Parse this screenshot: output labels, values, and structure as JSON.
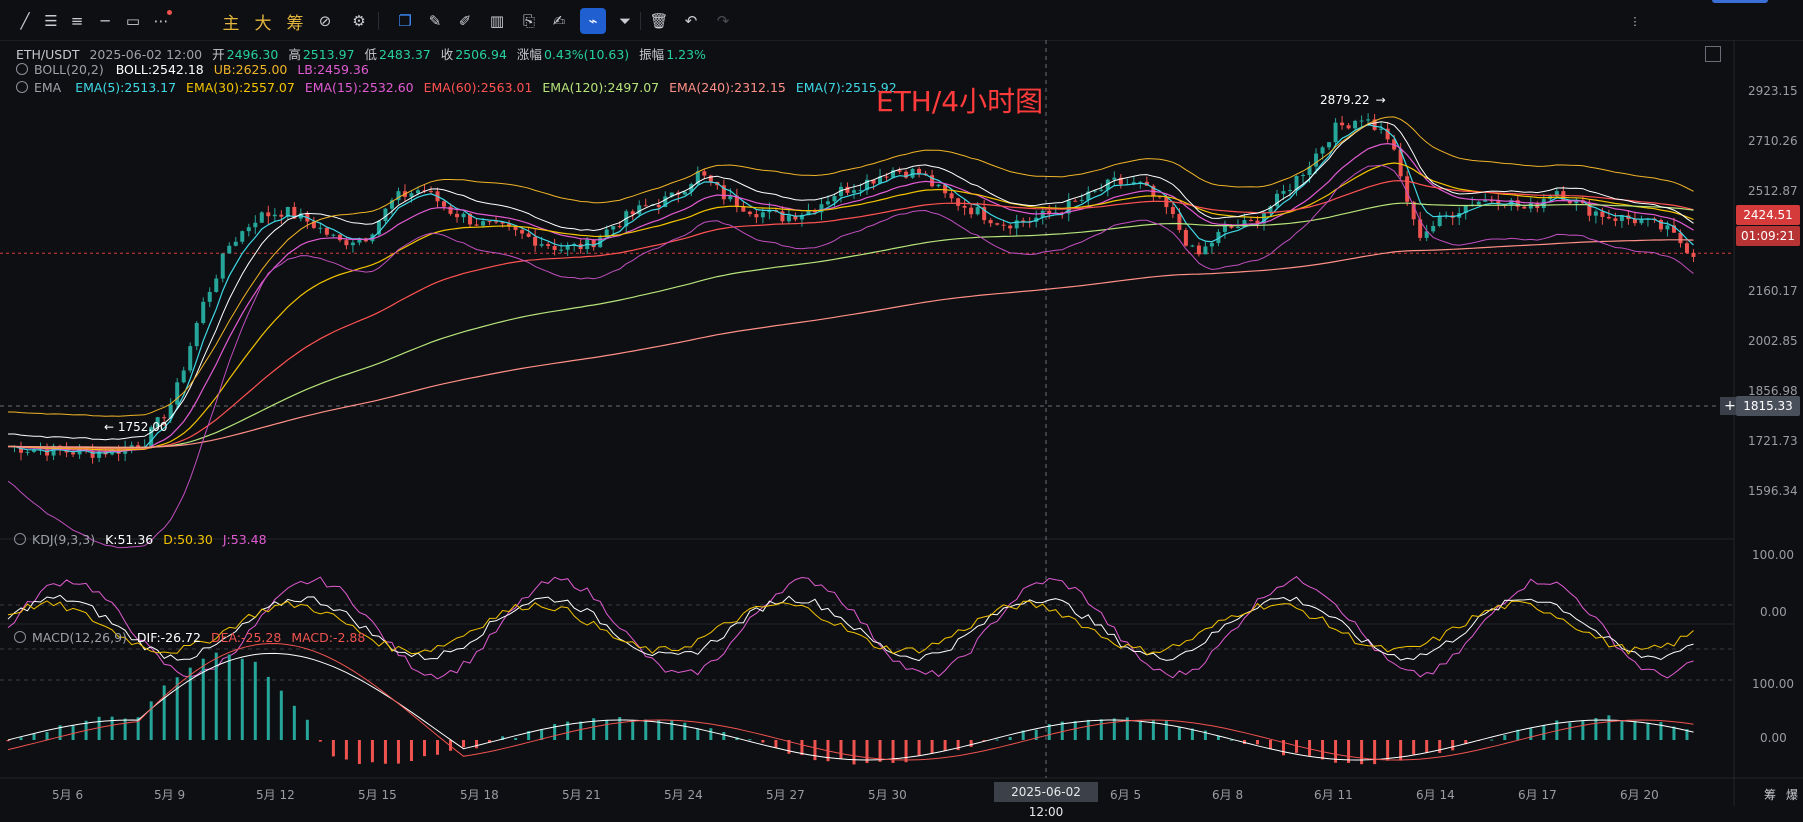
{
  "toolbar": {
    "tools": [
      "line-tool-icon",
      "hline-tool-icon",
      "menu-tool-icon",
      "hray-tool-icon",
      "rect-tool-icon",
      "more-tool-icon"
    ],
    "cn_buttons": [
      "主",
      "大",
      "筹"
    ],
    "tools_right": [
      "ruler-icon",
      "brush-icon",
      "bars-icon",
      "clip-icon",
      "note-icon",
      "magnet-icon",
      "filter-icon",
      "trash-icon",
      "undo-icon",
      "redo-icon"
    ]
  },
  "header": {
    "symbol": "ETH/USDT",
    "datetime": "2025-06-02 12:00",
    "open_label": "开",
    "open": "2496.30",
    "high_label": "高",
    "high": "2513.97",
    "low_label": "低",
    "low": "2483.37",
    "close_label": "收",
    "close": "2506.94",
    "change_label": "涨幅",
    "change": "0.43%(10.63)",
    "amp_label": "振幅",
    "amp": "1.23%"
  },
  "boll": {
    "name": "BOLL(20,2)",
    "boll": "BOLL:2542.18",
    "ub": "UB:2625.00",
    "lb": "LB:2459.36"
  },
  "ema": {
    "name": "EMA",
    "items": [
      {
        "label": "EMA(5):2513.17",
        "color": "#3fd9e6"
      },
      {
        "label": "EMA(30):2557.07",
        "color": "#f2c300"
      },
      {
        "label": "EMA(15):2532.60",
        "color": "#e15bd3"
      },
      {
        "label": "EMA(60):2563.01",
        "color": "#ff5252"
      },
      {
        "label": "EMA(120):2497.07",
        "color": "#b6e37a"
      },
      {
        "label": "EMA(240):2312.15",
        "color": "#ff8f87"
      },
      {
        "label": "EMA(7):2515.92",
        "color": "#3fd9e6"
      }
    ]
  },
  "title": "ETH/4小时图",
  "annotations": {
    "high": "2879.22",
    "low": "1752.00"
  },
  "price_axis": [
    "2923.15",
    "2710.26",
    "2512.87",
    "2160.17",
    "2002.85",
    "1856.98",
    "1721.73",
    "1596.34"
  ],
  "current_price": "2424.51",
  "countdown": "01:09:21",
  "crosshair_price": "1815.33",
  "kdj": {
    "name": "KDJ(9,3,3)",
    "k": "K:51.36",
    "d": "D:50.30",
    "j": "J:53.48",
    "axis": [
      "100.00",
      "0.00"
    ]
  },
  "macd": {
    "name": "MACD(12,26,9)",
    "dif": "DIF:-26.72",
    "dea": "DEA:-25.28",
    "macd": "MACD:-2.88",
    "axis": [
      "100.00",
      "0.00"
    ]
  },
  "time_axis": [
    "5月 6",
    "5月 9",
    "5月 12",
    "5月 15",
    "5月 18",
    "5月 21",
    "5月 24",
    "5月 27",
    "5月 30",
    "6月 5",
    "6月 8",
    "6月 11",
    "6月 14",
    "6月 17",
    "6月 20"
  ],
  "crosshair_time": "2025-06-02 12:00",
  "corner": [
    "筹",
    "爆"
  ],
  "colors": {
    "up": "#26a69a",
    "down": "#ef5350",
    "boll": "#f0b428",
    "lb": "#c04fc0"
  },
  "chart_data": {
    "type": "candlestick",
    "interval": "4h",
    "approx_closes": [
      1810,
      1800,
      1795,
      1790,
      1800,
      1830,
      1960,
      2250,
      2450,
      2540,
      2560,
      2520,
      2460,
      2480,
      2600,
      2630,
      2560,
      2520,
      2500,
      2470,
      2440,
      2450,
      2520,
      2570,
      2600,
      2680,
      2600,
      2560,
      2540,
      2560,
      2620,
      2650,
      2690,
      2680,
      2600,
      2560,
      2520,
      2530,
      2560,
      2600,
      2650,
      2640,
      2560,
      2410,
      2500,
      2520,
      2600,
      2700,
      2820,
      2860,
      2790,
      2480,
      2540,
      2590,
      2600,
      2560,
      2630,
      2570,
      2540,
      2530,
      2500,
      2424.51
    ],
    "ylim": [
      1560,
      2960
    ]
  }
}
